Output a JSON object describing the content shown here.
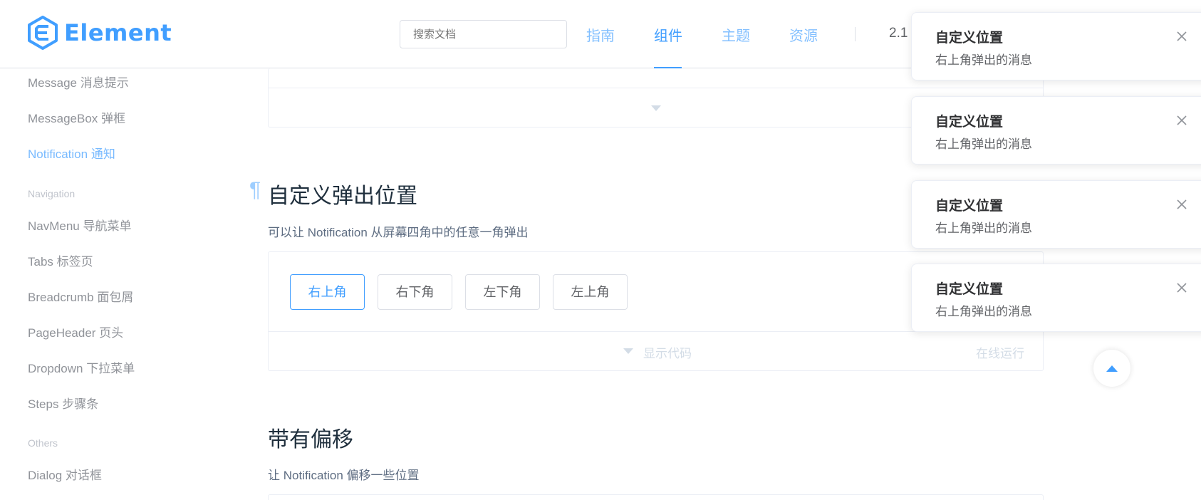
{
  "header": {
    "logo_text": "Element",
    "search_placeholder": "搜索文档",
    "nav": [
      "指南",
      "组件",
      "主题",
      "资源"
    ],
    "version": "2.1"
  },
  "sidebar": {
    "items_top": [
      "Message 消息提示",
      "MessageBox 弹框",
      "Notification 通知"
    ],
    "group_navigation": "Navigation",
    "items_navigation": [
      "NavMenu 导航菜单",
      "Tabs 标签页",
      "Breadcrumb 面包屑",
      "PageHeader 页头",
      "Dropdown 下拉菜单",
      "Steps 步骤条"
    ],
    "group_others": "Others",
    "items_others": [
      "Dialog 对话框"
    ]
  },
  "main": {
    "anchor": "¶",
    "section1_title": "自定义弹出位置",
    "section1_desc": "可以让 Notification 从屏幕四角中的任意一角弹出",
    "buttons": [
      "右上角",
      "右下角",
      "左下角",
      "左上角"
    ],
    "show_code": "显示代码",
    "run_online": "在线运行",
    "section2_title": "带有偏移",
    "section2_desc": "让 Notification 偏移一些位置"
  },
  "notifications": [
    {
      "title": "自定义位置",
      "message": "右上角弹出的消息"
    },
    {
      "title": "自定义位置",
      "message": "右上角弹出的消息"
    },
    {
      "title": "自定义位置",
      "message": "右上角弹出的消息"
    },
    {
      "title": "自定义位置",
      "message": "右上角弹出的消息"
    }
  ],
  "colors": {
    "primary": "#409eff",
    "text": "#606266",
    "title": "#1f2f3d",
    "border": "#ebeef5"
  }
}
